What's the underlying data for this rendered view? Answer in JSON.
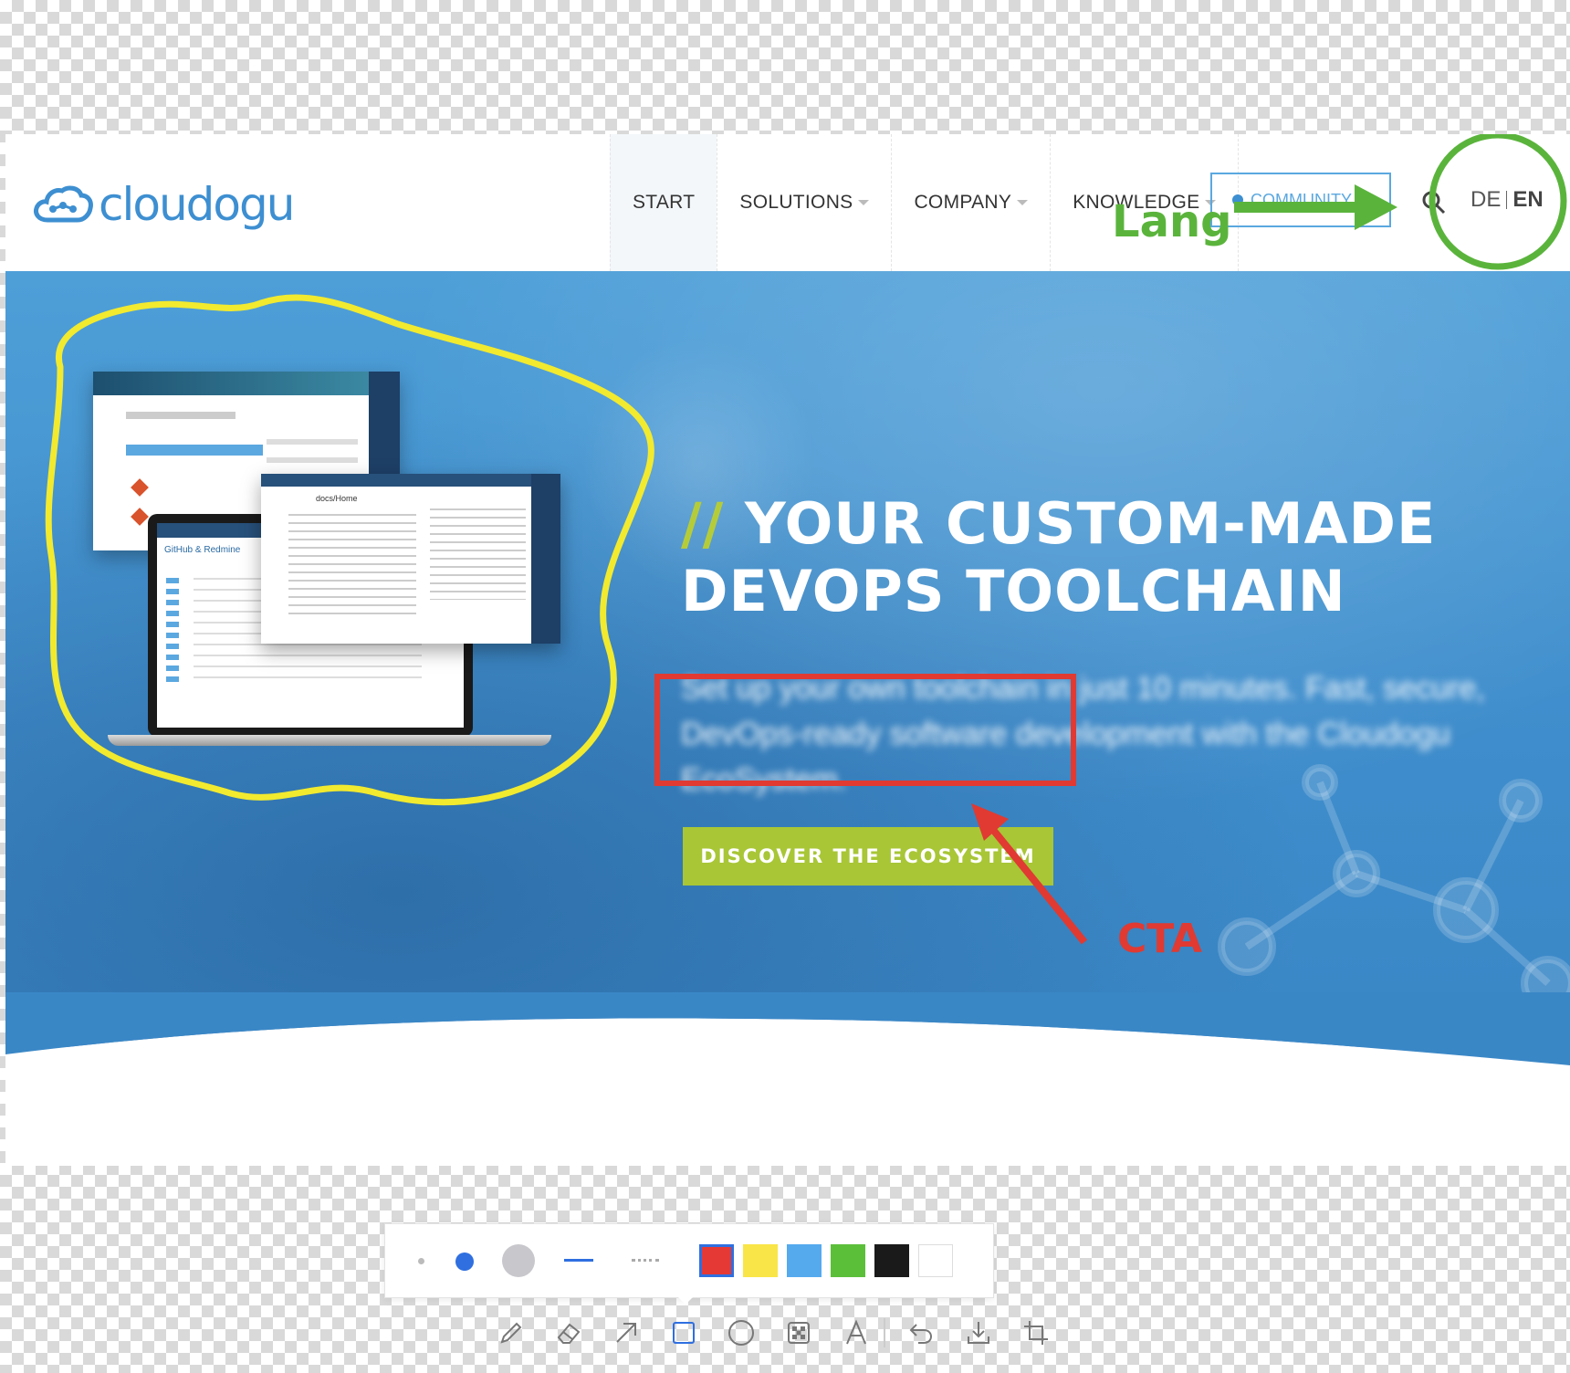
{
  "header": {
    "logo_text": "cloudogu",
    "nav": [
      {
        "label": "START",
        "active": true,
        "dropdown": false
      },
      {
        "label": "SOLUTIONS",
        "active": false,
        "dropdown": true
      },
      {
        "label": "COMPANY",
        "active": false,
        "dropdown": true
      },
      {
        "label": "KNOWLEDGE",
        "active": false,
        "dropdown": true
      }
    ],
    "community_label": "COMMUNITY",
    "lang": {
      "de": "DE",
      "en": "EN"
    }
  },
  "hero": {
    "slashes": "//",
    "headline_line1": "YOUR CUSTOM-MADE",
    "headline_line2": "DEVOPS TOOLCHAIN",
    "subtext": "Set up your own toolchain in just 10 minutes. Fast, secure, DevOps-ready software development with the Cloudogu EcoSystem.",
    "cta_label": "DISCOVER THE ECOSYSTEM"
  },
  "annotations": {
    "lang_label": "Lang",
    "cta_label": "CTA",
    "colors": {
      "green": "#5ab43c",
      "yellow": "#f2ea2e",
      "red": "#e03a32"
    }
  },
  "toolbar": {
    "stroke_sizes": [
      "small",
      "medium",
      "large"
    ],
    "line_styles": [
      "solid",
      "dashed"
    ],
    "colors": [
      "#e53935",
      "#f9e547",
      "#55aaee",
      "#5bbf3a",
      "#1a1a1a",
      "#ffffff"
    ],
    "selected_color": "#e53935",
    "tools": [
      "pencil-icon",
      "eraser-icon",
      "arrow-icon",
      "rectangle-icon",
      "circle-icon",
      "mosaic-icon",
      "text-icon",
      "undo-icon",
      "download-icon",
      "crop-icon"
    ],
    "active_tool": "rectangle-icon"
  }
}
